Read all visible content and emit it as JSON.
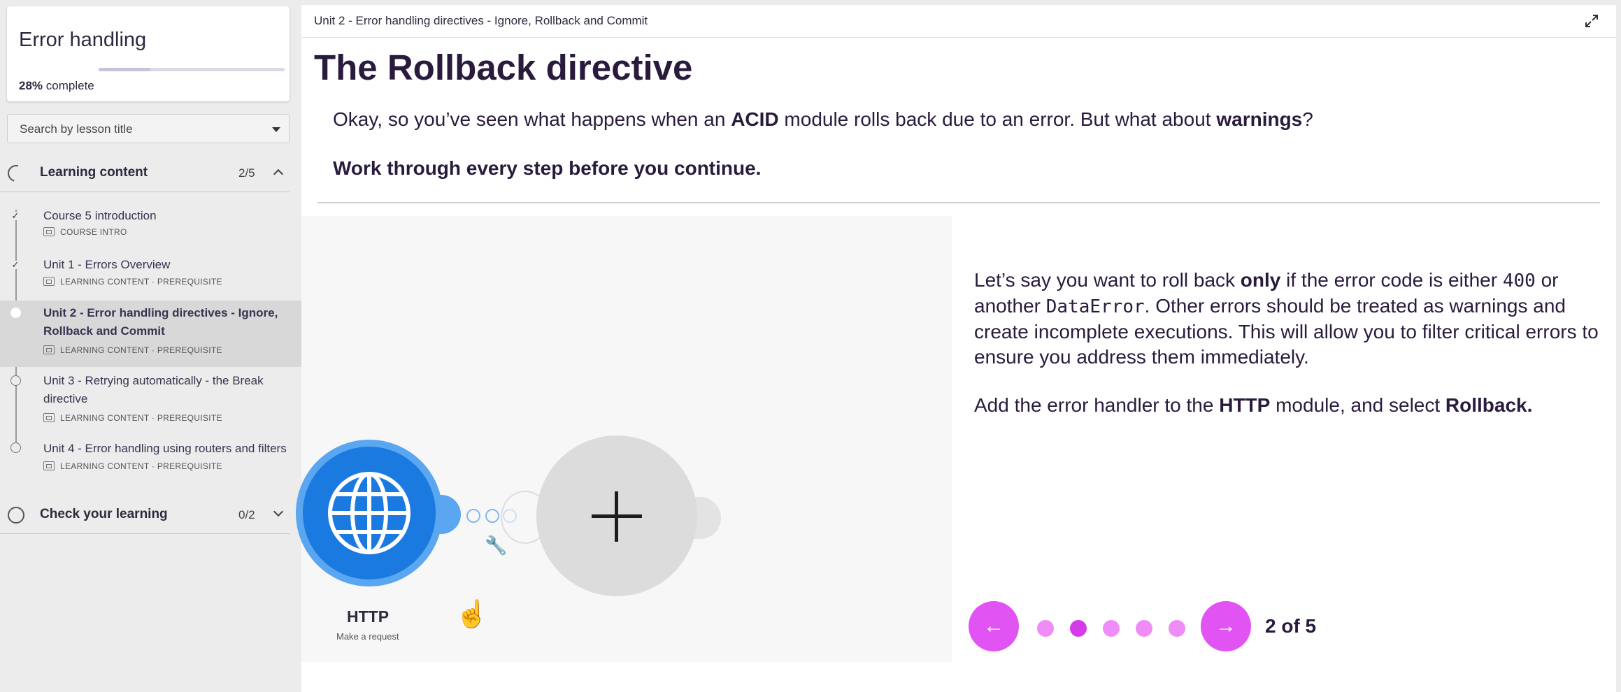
{
  "course": {
    "title": "Error handling",
    "progress_percent": 28,
    "progress_value": "28%",
    "progress_suffix": "complete"
  },
  "search": {
    "placeholder": "Search by lesson title"
  },
  "sections": [
    {
      "label": "Learning content",
      "count": "2/5",
      "expanded": true
    },
    {
      "label": "Check your learning",
      "count": "0/2",
      "expanded": false
    }
  ],
  "lessons": [
    {
      "title": "Course 5 introduction",
      "meta": "COURSE INTRO",
      "status": "done"
    },
    {
      "title": "Unit 1 - Errors Overview",
      "meta": "LEARNING CONTENT · PREREQUISITE",
      "status": "done"
    },
    {
      "title": "Unit 2 - Error handling directives - Ignore, Rollback and Commit",
      "meta": "LEARNING CONTENT · PREREQUISITE",
      "status": "current"
    },
    {
      "title": "Unit 3 - Retrying automatically - the Break directive",
      "meta": "LEARNING CONTENT · PREREQUISITE",
      "status": "todo"
    },
    {
      "title": "Unit 4 - Error handling using routers and filters",
      "meta": "LEARNING CONTENT · PREREQUISITE",
      "status": "todo"
    }
  ],
  "main": {
    "breadcrumb": "Unit 2 - Error handling directives - Ignore, Rollback and Commit",
    "title": "The Rollback directive",
    "intro": {
      "t1": "Okay, so you’ve seen what happens when an ",
      "b1": "ACID",
      "t2": " module rolls back due to an error. But what about ",
      "b2": "warnings",
      "t3": "?"
    },
    "instruction": "Work through every step before you continue."
  },
  "scenario": {
    "module_name": "HTTP",
    "module_action": "Make a request"
  },
  "step": {
    "p1": {
      "t1": "Let’s say you want to roll back ",
      "b1": "only",
      "t2": " if the error code is either ",
      "c1": "400",
      "t3": " or another ",
      "c2": "DataError",
      "t4": ". Other errors should be treated as warnings and create incomplete executions. This will allow you to filter critical errors to ensure you address them immediately."
    },
    "p2": {
      "t1": "Add the error handler to the ",
      "b1": "HTTP",
      "t2": " module, and select ",
      "b2": "Rollback."
    }
  },
  "navigation": {
    "prev_icon": "arrow-left-icon",
    "next_icon": "arrow-right-icon",
    "current": 2,
    "total": 5,
    "label": "2 of 5"
  },
  "colors": {
    "accent": "#e154f3",
    "dot_inactive": "#ef8cf7",
    "dot_active": "#d63bea",
    "http_blue": "#1a7ae0",
    "heading": "#2a1b3d"
  }
}
